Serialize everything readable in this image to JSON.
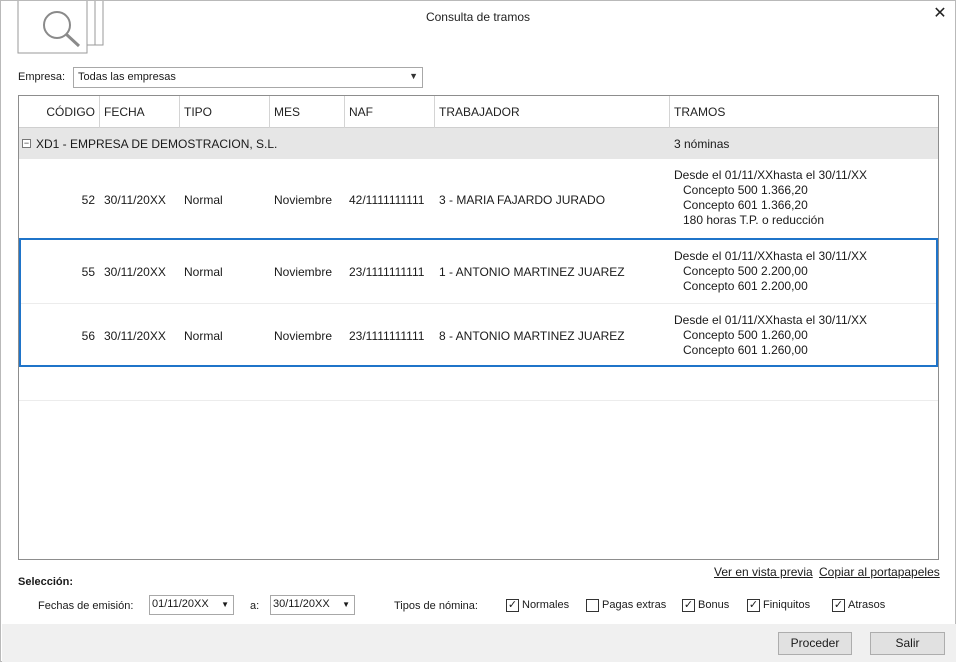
{
  "window": {
    "title": "Consulta de tramos"
  },
  "empresa": {
    "label": "Empresa:",
    "value": "Todas las empresas"
  },
  "grid": {
    "columns": [
      "CÓDIGO",
      "FECHA",
      "TIPO",
      "MES",
      "NAF",
      "TRABAJADOR",
      "TRAMOS"
    ],
    "group": {
      "name": "XD1 - EMPRESA DE DEMOSTRACION, S.L.",
      "count": "3 nóminas"
    },
    "rows": [
      {
        "codigo": "52",
        "fecha": "30/11/20XX",
        "tipo": "Normal",
        "mes": "Noviembre",
        "naf": "42/1111111111",
        "trabajador": "3 - MARIA FAJARDO JURADO",
        "tramos": [
          "Desde el 01/11/XXhasta el 30/11/XX",
          "Concepto 500 1.366,20",
          "Concepto 601 1.366,20",
          "180 horas T.P. o reducción"
        ]
      },
      {
        "codigo": "55",
        "fecha": "30/11/20XX",
        "tipo": "Normal",
        "mes": "Noviembre",
        "naf": "23/1111111111",
        "trabajador": "1 - ANTONIO MARTINEZ JUAREZ",
        "tramos": [
          "Desde el 01/11/XXhasta el 30/11/XX",
          "Concepto 500 2.200,00",
          "Concepto 601 2.200,00"
        ]
      },
      {
        "codigo": "56",
        "fecha": "30/11/20XX",
        "tipo": "Normal",
        "mes": "Noviembre",
        "naf": "23/1111111111",
        "trabajador": "8 - ANTONIO MARTINEZ JUAREZ",
        "tramos": [
          "Desde el 01/11/XXhasta el 30/11/XX",
          "Concepto 500 1.260,00",
          "Concepto 601 1.260,00"
        ]
      }
    ]
  },
  "links": {
    "preview": "Ver en vista previa",
    "copy": "Copiar al portapapeles"
  },
  "seleccion": {
    "title": "Selección:",
    "fechas_label": "Fechas de emisión:",
    "desde": "01/11/20XX",
    "a_label": "a:",
    "hasta": "30/11/20XX",
    "tipos_label": "Tipos de nómina:",
    "tipos": [
      {
        "label": "Normales",
        "checked": true
      },
      {
        "label": "Pagas extras",
        "checked": false
      },
      {
        "label": "Bonus",
        "checked": true
      },
      {
        "label": "Finiquitos",
        "checked": true
      },
      {
        "label": "Atrasos",
        "checked": true
      }
    ]
  },
  "buttons": {
    "proceder": "Proceder",
    "salir": "Salir"
  },
  "colors": {
    "selection_border": "#1f74c9",
    "group_bg": "#e6e6e6"
  }
}
